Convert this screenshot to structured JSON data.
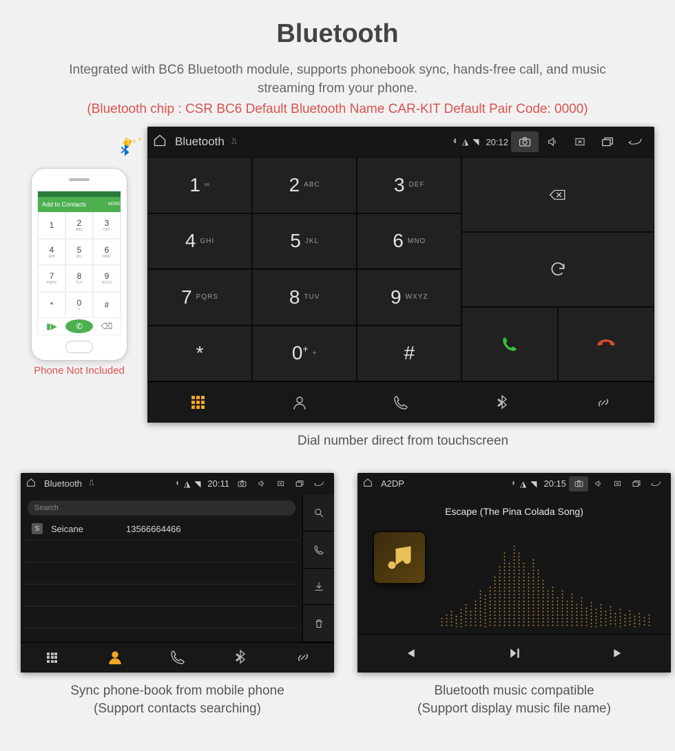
{
  "page": {
    "title": "Bluetooth",
    "subtitle": "Integrated with BC6 Bluetooth module, supports phonebook sync, hands-free call, and music streaming from your phone.",
    "specs": "(Bluetooth chip : CSR BC6     Default Bluetooth Name CAR-KIT     Default Pair Code: 0000)",
    "phone_not_included": "Phone Not Included",
    "caption_dialer": "Dial number direct from touchscreen",
    "caption_phonebook_l1": "Sync phone-book from mobile phone",
    "caption_phonebook_l2": "(Support contacts searching)",
    "caption_a2dp_l1": "Bluetooth music compatible",
    "caption_a2dp_l2": "(Support display music file name)"
  },
  "phone_mock": {
    "add_bar": "Add to Contacts",
    "more": "MORE",
    "keys": [
      {
        "d": "1",
        "l": ""
      },
      {
        "d": "2",
        "l": "ABC"
      },
      {
        "d": "3",
        "l": "DEF"
      },
      {
        "d": "4",
        "l": "GHI"
      },
      {
        "d": "5",
        "l": "JKL"
      },
      {
        "d": "6",
        "l": "MNO"
      },
      {
        "d": "7",
        "l": "PQRS"
      },
      {
        "d": "8",
        "l": "TUV"
      },
      {
        "d": "9",
        "l": "WXYZ"
      },
      {
        "d": "*",
        "l": ""
      },
      {
        "d": "0",
        "l": "+"
      },
      {
        "d": "#",
        "l": ""
      }
    ]
  },
  "dialer": {
    "title": "Bluetooth",
    "clock": "20:12",
    "keys": [
      {
        "d": "1",
        "l": "∞"
      },
      {
        "d": "2",
        "l": "ABC"
      },
      {
        "d": "3",
        "l": "DEF"
      },
      {
        "d": "4",
        "l": "GHI"
      },
      {
        "d": "5",
        "l": "JKL"
      },
      {
        "d": "6",
        "l": "MNO"
      },
      {
        "d": "7",
        "l": "PQRS"
      },
      {
        "d": "8",
        "l": "TUV"
      },
      {
        "d": "9",
        "l": "WXYZ"
      },
      {
        "d": "*",
        "l": ""
      },
      {
        "d": "0",
        "l": "+",
        "sup": "+"
      },
      {
        "d": "#",
        "l": ""
      }
    ]
  },
  "phonebook": {
    "title": "Bluetooth",
    "clock": "20:11",
    "search_placeholder": "Search",
    "contact_badge": "S",
    "contact_name": "Seicane",
    "contact_number": "13566664466"
  },
  "a2dp": {
    "title": "A2DP",
    "clock": "20:15",
    "track": "Escape (The Pina Colada Song)"
  },
  "colors": {
    "accent_red": "#d9534f",
    "accent_orange": "#f5a623",
    "call_green": "#3bbf3b",
    "hangup_red": "#d94a2b"
  }
}
